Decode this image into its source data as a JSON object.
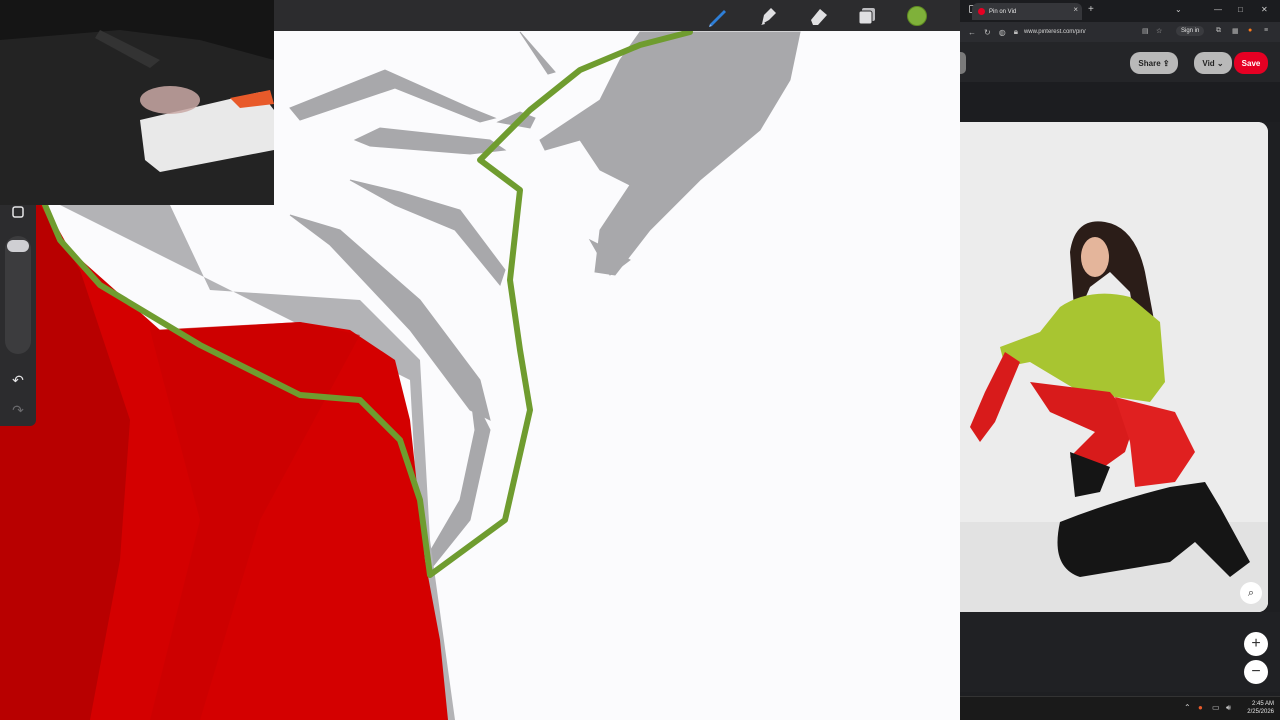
{
  "drawing_app": {
    "toolbar": {
      "tools": [
        "brush-icon",
        "smudge-icon",
        "eraser-icon",
        "layers-icon"
      ],
      "active_color": "#7fb13a"
    },
    "side_toolbar": {
      "undo_symbol": "↶",
      "redo_symbol": "↷"
    }
  },
  "browser": {
    "tab_title": "Pin on Vid",
    "tab_close": "×",
    "new_tab": "+",
    "url": "www.pinterest.com/pin/",
    "sign_in": "Sign in",
    "share_label": "Share",
    "vid_label": "Vid",
    "save_label": "Save",
    "zoom_in": "+",
    "zoom_out": "−"
  },
  "taskbar": {
    "time": "2:45 AM",
    "date": "2/25/2026"
  },
  "colors": {
    "accent_green": "#7fb13a",
    "pinterest_red": "#e60023",
    "figure_red": "#d40000",
    "sketch_gray": "#a8a8ab"
  }
}
